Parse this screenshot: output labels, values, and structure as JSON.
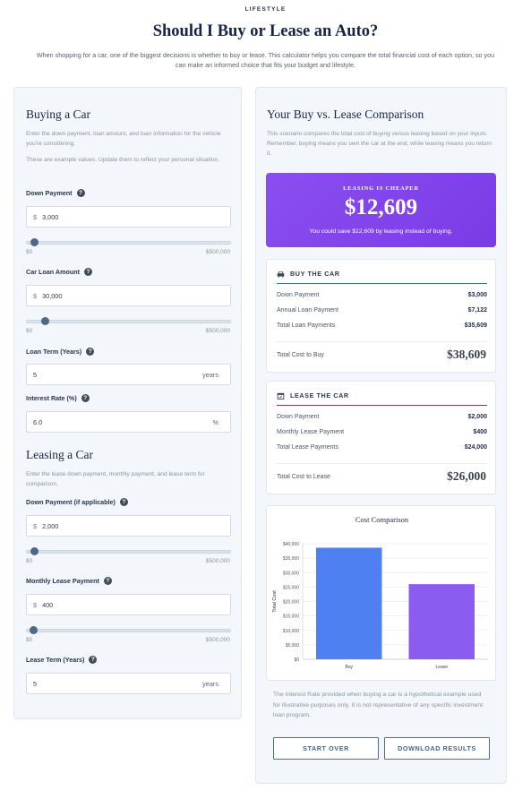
{
  "header": {
    "eyebrow": "LIFESTYLE",
    "title": "Should I Buy or Lease an Auto?",
    "subtitle": "When shopping for a car, one of the biggest decisions is whether to buy or lease. This calculator helps you compare the total financial cost of each option, so you can make an informed choice that fits your budget and lifestyle."
  },
  "buying": {
    "title": "Buying a Car",
    "desc1": "Enter the down payment, loan amount, and loan information for the vehicle you're considering.",
    "desc2": "These are example values. Update them to reflect your personal situation.",
    "down_payment": {
      "label": "Down Payment",
      "prefix": "$",
      "value": "3,000",
      "min": "$0",
      "max": "$500,000",
      "fraction": 0.006
    },
    "loan_amount": {
      "label": "Car Loan Amount",
      "prefix": "$",
      "value": "30,000",
      "min": "$0",
      "max": "$500,000",
      "fraction": 0.06
    },
    "loan_term": {
      "label": "Loan Term (Years)",
      "value": "5",
      "suffix": "years"
    },
    "interest_rate": {
      "label": "Interest Rate (%)",
      "value": "6.0",
      "suffix": "%"
    }
  },
  "leasing": {
    "title": "Leasing a Car",
    "desc": "Enter the lease down payment, monthly payment, and lease term for comparison.",
    "down_payment": {
      "label": "Down Payment (if applicable)",
      "prefix": "$",
      "value": "2,000",
      "min": "$0",
      "max": "$500,000",
      "fraction": 0.004
    },
    "monthly_payment": {
      "label": "Monthly Lease Payment",
      "prefix": "$",
      "value": "400",
      "min": "$0",
      "max": "$500,000",
      "fraction": 0.001
    },
    "lease_term": {
      "label": "Lease Term (Years)",
      "value": "5",
      "suffix": "years"
    }
  },
  "comparison": {
    "title": "Your Buy vs. Lease Comparison",
    "desc": "This scenario compares the total cost of buying versus leasing based on your inputs. Remember, buying means you own the car at the end, while leasing means you return it.",
    "promo": {
      "kicker": "LEASING IS CHEAPER",
      "amount": "$12,609",
      "note": "You could save $12,609 by leasing instead of buying.",
      "color": "#8a4ef0"
    },
    "buy": {
      "head": "BUY THE CAR",
      "icon": "car-icon",
      "line_color": "#4c6f9a",
      "rows": [
        {
          "label": "Down Payment",
          "value": "$3,000"
        },
        {
          "label": "Annual Loan Payment",
          "value": "$7,122"
        },
        {
          "label": "Total Loan Payments",
          "value": "$35,609"
        }
      ],
      "total_label": "Total Cost to Buy",
      "total_value": "$38,609"
    },
    "lease": {
      "head": "LEASE THE CAR",
      "icon": "calendar-icon",
      "line_color": "#8a3b5e",
      "rows": [
        {
          "label": "Down Payment",
          "value": "$2,000"
        },
        {
          "label": "Monthly Lease Payment",
          "value": "$400"
        },
        {
          "label": "Total Lease Payments",
          "value": "$24,000"
        }
      ],
      "total_label": "Total Cost to Lease",
      "total_value": "$26,000"
    },
    "disclaimer": "The Interest Rate provided when buying a car is a hypothetical example used for illustrative purposes only. It is not representative of any specific investment loan program.",
    "buttons": {
      "start_over": "START OVER",
      "download": "DOWNLOAD RESULTS"
    }
  },
  "chart_data": {
    "type": "bar",
    "title": "Cost Comparison",
    "ylabel": "Total Cost",
    "xlabel": "",
    "categories": [
      "Buy",
      "Lease"
    ],
    "values": [
      38609,
      26000
    ],
    "colors": [
      "#4f80f2",
      "#8a5cf0"
    ],
    "ylim": [
      0,
      40000
    ],
    "yticks": [
      "$0",
      "$5,000",
      "$10,000",
      "$15,000",
      "$20,000",
      "$25,000",
      "$30,000",
      "$35,000",
      "$40,000"
    ],
    "grid": true
  }
}
